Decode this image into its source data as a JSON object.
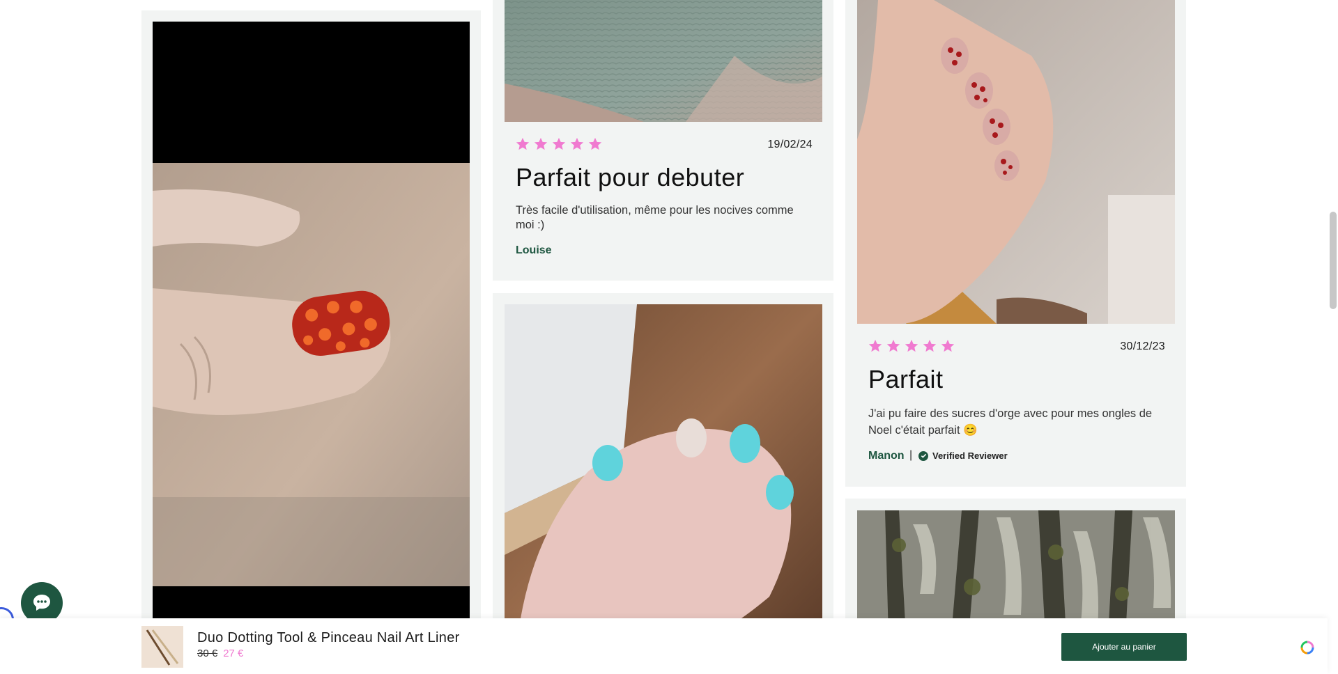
{
  "colors": {
    "star": "#f07ad0",
    "brand_green": "#1e5640",
    "card_bg": "#f2f4f3",
    "sale_price": "#f07ad0"
  },
  "reviews": [
    {
      "date": "19/02/24",
      "rating": 5,
      "title": "Parfait pour debuter",
      "body": "Très facile d'utilisation, même pour les nocives comme moi :)",
      "author": "Louise"
    },
    {
      "date": "30/12/23",
      "rating": 5,
      "title": "Parfait",
      "body": "J'ai pu faire des sucres d'orge avec pour mes ongles de Noel c'était parfait 😊",
      "author": "Manon",
      "separator": "|",
      "verified_label": "Verified Reviewer"
    }
  ],
  "sticky_bar": {
    "product_name": "Duo Dotting Tool & Pinceau Nail Art Liner",
    "old_price": "30 €",
    "new_price": "27 €",
    "cta_label": "Ajouter au panier"
  },
  "icons": {
    "chat": "chat-bubble-icon",
    "star": "star-icon",
    "verified": "check-circle-icon",
    "widget": "loop-widget-icon"
  }
}
